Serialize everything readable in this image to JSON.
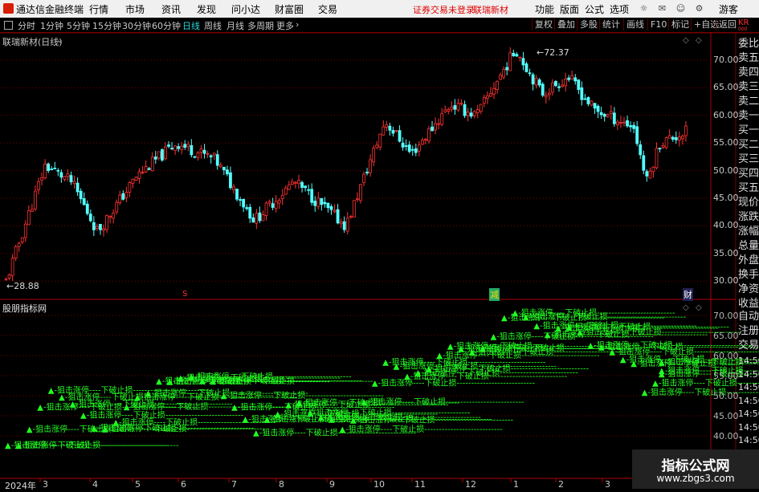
{
  "app": {
    "name": "通达信金融终端"
  },
  "menu": [
    "行情",
    "市场",
    "资讯",
    "发现",
    "问小达",
    "财富圈",
    "交易"
  ],
  "warning": {
    "login": "证券交易未登录",
    "stock": "联瑞新材"
  },
  "right_menu": [
    "功能",
    "版面",
    "公式",
    "选项"
  ],
  "user": "游客",
  "toolbar": {
    "periods": [
      "分时",
      "1分钟",
      "5分钟",
      "15分钟",
      "30分钟",
      "60分钟",
      "日线",
      "周线",
      "月线",
      "多周期",
      "更多"
    ],
    "selected": "日线",
    "right": [
      "复权",
      "叠加",
      "多股",
      "统计",
      "画线",
      "F10",
      "标记",
      "+自选",
      "返回"
    ]
  },
  "main_chart": {
    "title": "联瑞新材(日线)",
    "high_label": "72.37",
    "low_label": "28.88",
    "yticks": [
      "70.00",
      "65.00",
      "60.00",
      "55.00",
      "50.00",
      "45.00",
      "40.00",
      "35.00",
      "30.00"
    ],
    "marker_s": "S",
    "marker_jian": "减",
    "marker_cai": "财"
  },
  "indicator": {
    "title": "股朋指标网",
    "yticks": [
      "70.00",
      "65.00",
      "60.00",
      "55.00",
      "50.00",
      "45.00",
      "40.00"
    ],
    "signal_text": "▲-狙击涨停----下破止损---------------------------"
  },
  "side_panel": {
    "top_code": "KR",
    "labels": [
      "委比",
      "卖五",
      "卖四",
      "卖三",
      "卖二",
      "卖一",
      "买一",
      "买二",
      "买三",
      "买四",
      "买五",
      "现价",
      "涨跌",
      "涨幅",
      "总量",
      "外盘",
      "换手",
      "净资",
      "收益"
    ],
    "bottom_labels": [
      "自动",
      "注册",
      "交易"
    ],
    "times": [
      "14:50",
      "14:50",
      "14:50",
      "14:50",
      "14:50",
      "14:50",
      "14:50"
    ]
  },
  "xaxis": {
    "year": "2024年",
    "months": [
      "3",
      "4",
      "5",
      "6",
      "7",
      "8",
      "9",
      "10",
      "11",
      "12",
      "1",
      "2",
      "3"
    ]
  },
  "watermark": {
    "title": "指标公式网",
    "url": "www.zbgs3.com"
  },
  "colors": {
    "up": "#ff3232",
    "down": "#54ffff",
    "signal": "#22ff22",
    "grid": "#7a0000",
    "accent": "#2bd6d6"
  },
  "chart_data": {
    "type": "candlestick",
    "title": "联瑞新材(日线)",
    "ylim": [
      28,
      75
    ],
    "peaks": [
      [
        0,
        30
      ],
      [
        6,
        51
      ],
      [
        10,
        48
      ],
      [
        14,
        39
      ],
      [
        20,
        49
      ],
      [
        26,
        55
      ],
      [
        32,
        52
      ],
      [
        38,
        41
      ],
      [
        44,
        48
      ],
      [
        52,
        40
      ],
      [
        58,
        59
      ],
      [
        62,
        53
      ],
      [
        68,
        62
      ],
      [
        72,
        60
      ],
      [
        78,
        72
      ],
      [
        82,
        64
      ],
      [
        86,
        67
      ],
      [
        90,
        61
      ],
      [
        96,
        58
      ],
      [
        98,
        48
      ],
      [
        100,
        55
      ],
      [
        104,
        57
      ]
    ]
  }
}
